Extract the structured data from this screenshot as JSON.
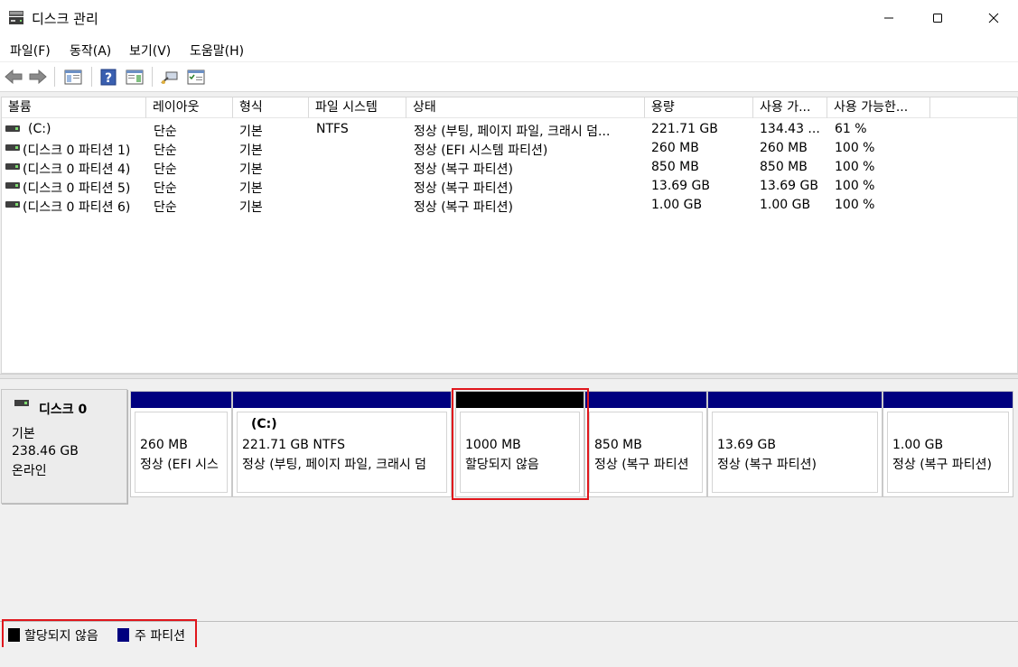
{
  "window": {
    "title": "디스크 관리",
    "minimize_glyph": "—",
    "maximize_glyph": "☐",
    "close_glyph": "✕"
  },
  "menu": [
    {
      "label": "파일(F)"
    },
    {
      "label": "동작(A)"
    },
    {
      "label": "보기(V)"
    },
    {
      "label": "도움말(H)"
    }
  ],
  "toolbar": {
    "icons": [
      "back-arrow-icon",
      "forward-arrow-icon",
      "show-hide-console-tree-icon",
      "help-icon",
      "show-hide-action-pane-icon",
      "connect-icon",
      "properties-icon"
    ]
  },
  "volume_list": {
    "columns": [
      "볼륨",
      "레이아웃",
      "형식",
      "파일 시스템",
      "상태",
      "용량",
      "사용 가...",
      "사용 가능한..."
    ],
    "rows": [
      {
        "volume": "(C:)",
        "layout": "단순",
        "type": "기본",
        "fs": "NTFS",
        "status": "정상 (부팅, 페이지 파일, 크래시 덤...",
        "capacity": "221.71 GB",
        "free": "134.43 ...",
        "pct": "61 %"
      },
      {
        "volume": "(디스크 0 파티션 1)",
        "layout": "단순",
        "type": "기본",
        "fs": "",
        "status": "정상 (EFI 시스템 파티션)",
        "capacity": "260 MB",
        "free": "260 MB",
        "pct": "100 %"
      },
      {
        "volume": "(디스크 0 파티션 4)",
        "layout": "단순",
        "type": "기본",
        "fs": "",
        "status": "정상 (복구 파티션)",
        "capacity": "850 MB",
        "free": "850 MB",
        "pct": "100 %"
      },
      {
        "volume": "(디스크 0 파티션 5)",
        "layout": "단순",
        "type": "기본",
        "fs": "",
        "status": "정상 (복구 파티션)",
        "capacity": "13.69 GB",
        "free": "13.69 GB",
        "pct": "100 %"
      },
      {
        "volume": "(디스크 0 파티션 6)",
        "layout": "단순",
        "type": "기본",
        "fs": "",
        "status": "정상 (복구 파티션)",
        "capacity": "1.00 GB",
        "free": "1.00 GB",
        "pct": "100 %"
      }
    ]
  },
  "disk": {
    "name": "디스크 0",
    "type": "기본",
    "size": "238.46 GB",
    "state": "온라인",
    "partitions": [
      {
        "title": "",
        "size": "260 MB",
        "status": "정상 (EFI 시스",
        "kind": "primary"
      },
      {
        "title": "(C:)",
        "size": "221.71 GB NTFS",
        "status": "정상 (부팅, 페이지 파일, 크래시 덤",
        "kind": "primary"
      },
      {
        "title": "",
        "size": "1000 MB",
        "status": "할당되지 않음",
        "kind": "unallocated"
      },
      {
        "title": "",
        "size": "850 MB",
        "status": "정상 (복구 파티션",
        "kind": "primary"
      },
      {
        "title": "",
        "size": "13.69 GB",
        "status": "정상 (복구 파티션)",
        "kind": "primary"
      },
      {
        "title": "",
        "size": "1.00 GB",
        "status": "정상 (복구 파티션)",
        "kind": "primary"
      }
    ]
  },
  "legend": [
    {
      "label": "할당되지 않음",
      "color": "#000000"
    },
    {
      "label": "주 파티션",
      "color": "#00007f"
    }
  ],
  "colors": {
    "primary_bar": "#00007f",
    "unallocated_bar": "#000000",
    "highlight": "#e0161c"
  }
}
